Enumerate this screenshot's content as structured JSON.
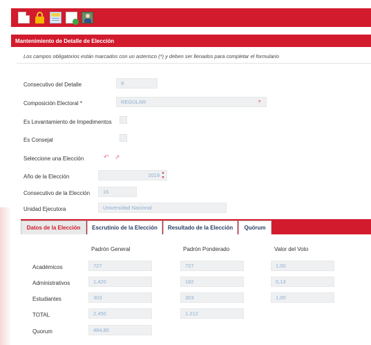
{
  "toolbar": {
    "icons": [
      "new-document-icon",
      "lock-icon",
      "spreadsheet-icon",
      "page-go-icon",
      "user-add-icon"
    ]
  },
  "section_title": "Mantenimiento de Detalle de Elección",
  "notice": "Los campos obligatorios están marcados con un asterisco (*) y deben ser llenados para completar el formulario",
  "form": {
    "consecutivo_label": "Consecutivo del Detalle",
    "consecutivo_value": "9",
    "composicion_label": "Composición Electoral *",
    "composicion_value": "REGULAR",
    "levantamiento_label": "Es Levantamiento de Impedimentos",
    "consejal_label": "Es Consejal",
    "seleccione_label": "Seleccione una Elección",
    "anio_label": "Año de la Elección",
    "anio_value": "2019",
    "consec_eleccion_label": "Consecutivo de la Elección",
    "consec_eleccion_value": "16",
    "unidad_label": "Unidad Ejecutora",
    "unidad_value": "Universidad Nacional"
  },
  "tabs": [
    {
      "label": "Datos de la Elección",
      "active": true
    },
    {
      "label": "Escrutinio de la Elección",
      "active": false
    },
    {
      "label": "Resultado de la Elección",
      "active": false
    },
    {
      "label": "Quórum",
      "active": false
    }
  ],
  "table": {
    "headers": [
      "Padrón General",
      "Padrón Ponderado",
      "Valor del Voto"
    ],
    "rows": [
      {
        "label": "Académicos",
        "general": "727",
        "ponderado": "727",
        "valor": "1,00"
      },
      {
        "label": "Administrativos",
        "general": "1,420",
        "ponderado": "182",
        "valor": "0,13"
      },
      {
        "label": "Estudiantes",
        "general": "303",
        "ponderado": "303",
        "valor": "1,00"
      },
      {
        "label": "TOTAL",
        "general": "2,450",
        "ponderado": "1.212",
        "valor": null
      }
    ],
    "quorum_label": "Quorum",
    "quorum_value": "484,80"
  },
  "colors": {
    "accent": "#d21b2d",
    "field_bg": "#eef0f2",
    "field_text": "#8eaed0",
    "tab_text": "#2a3f66"
  }
}
